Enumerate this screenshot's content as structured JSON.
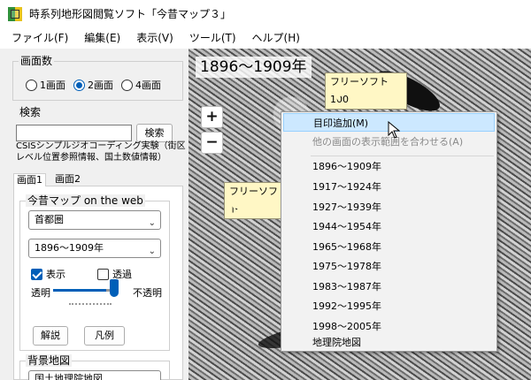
{
  "window": {
    "title": "時系列地形図閲覧ソフト「今昔マップ３」"
  },
  "menubar": [
    {
      "label": "ファイル(F)"
    },
    {
      "label": "編集(E)"
    },
    {
      "label": "表示(V)"
    },
    {
      "label": "ツール(T)"
    },
    {
      "label": "ヘルプ(H)"
    }
  ],
  "left_panel": {
    "screen_count": {
      "title": "画面数",
      "options": [
        {
          "label": "1画面",
          "checked": false
        },
        {
          "label": "2画面",
          "checked": true
        },
        {
          "label": "4画面",
          "checked": false
        }
      ]
    },
    "search": {
      "title": "検索",
      "value": "",
      "button": "検索",
      "note": "CSISシンプルジオコーディング実験（街区レベル位置参照情報、国土数値情報）"
    },
    "tabs": [
      {
        "label": "画面1",
        "active": true
      },
      {
        "label": "画面2",
        "active": false
      }
    ],
    "web_map": {
      "title": "今昔マップ on the web",
      "region": "首都圏",
      "period": "1896～1909年",
      "display_label": "表示",
      "display_checked": true,
      "transparent_label": "透過",
      "transparent_checked": false,
      "opacity_left": "透明",
      "opacity_right": "不透明",
      "opacity_level": 1.0,
      "explain_button": "解説",
      "legend_button": "凡例"
    },
    "background_map": {
      "title": "背景地図",
      "selected": "国土地理院地図"
    }
  },
  "map": {
    "year_label": "1896～1909年",
    "balloons": [
      "フリーソフト100",
      "フリーソフト"
    ],
    "zoom_in": "+",
    "zoom_out": "−"
  },
  "context_menu": {
    "items": [
      {
        "label": "目印追加(M)",
        "state": "active"
      },
      {
        "label": "他の画面の表示範囲を合わせる(A)",
        "state": "disabled"
      },
      {
        "label": "1896～1909年",
        "state": "normal"
      },
      {
        "label": "1917～1924年",
        "state": "normal"
      },
      {
        "label": "1927～1939年",
        "state": "normal"
      },
      {
        "label": "1944～1954年",
        "state": "normal"
      },
      {
        "label": "1965～1968年",
        "state": "normal"
      },
      {
        "label": "1975～1978年",
        "state": "normal"
      },
      {
        "label": "1983～1987年",
        "state": "normal"
      },
      {
        "label": "1992～1995年",
        "state": "normal"
      },
      {
        "label": "1998～2005年",
        "state": "normal"
      },
      {
        "label": "地理院地図",
        "state": "normal"
      }
    ]
  },
  "colors": {
    "accent": "#005fb8",
    "menu_highlight": "#cce8ff",
    "balloon": "#fff7c5"
  }
}
